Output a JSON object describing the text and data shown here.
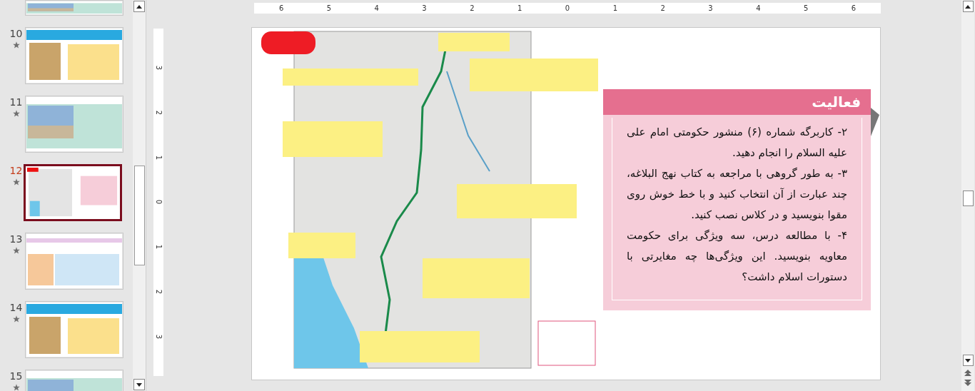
{
  "slide_panel": {
    "slides": [
      {
        "number": "10",
        "selected": false
      },
      {
        "number": "11",
        "selected": false
      },
      {
        "number": "12",
        "selected": true
      },
      {
        "number": "13",
        "selected": false
      },
      {
        "number": "14",
        "selected": false
      },
      {
        "number": "15",
        "selected": false
      }
    ]
  },
  "rulers": {
    "horizontal": [
      "6",
      "5",
      "4",
      "3",
      "2",
      "1",
      "0",
      "1",
      "2",
      "3",
      "4",
      "5",
      "6"
    ],
    "vertical": [
      "3",
      "2",
      "1",
      "0",
      "1",
      "2",
      "3"
    ]
  },
  "slide": {
    "activity": {
      "title": "فعالیت",
      "paragraphs": [
        "۲- کاربرگه شماره (۶) منشور حکومتی امام علی علیه السلام را انجام دهید.",
        "۳- به طور گروهی با مراجعه به کتاب نهج البلاغه، چند عبارت از آن انتخاب کنید و با خط خوش روی مقوا بنویسید و در کلاس نصب کنید.",
        "۴- با مطالعه درس، سه ویژگی برای حکومت معاویه بنویسید. این ویژگی‌ها چه مغایرتی با دستورات اسلام داشت؟"
      ]
    }
  }
}
